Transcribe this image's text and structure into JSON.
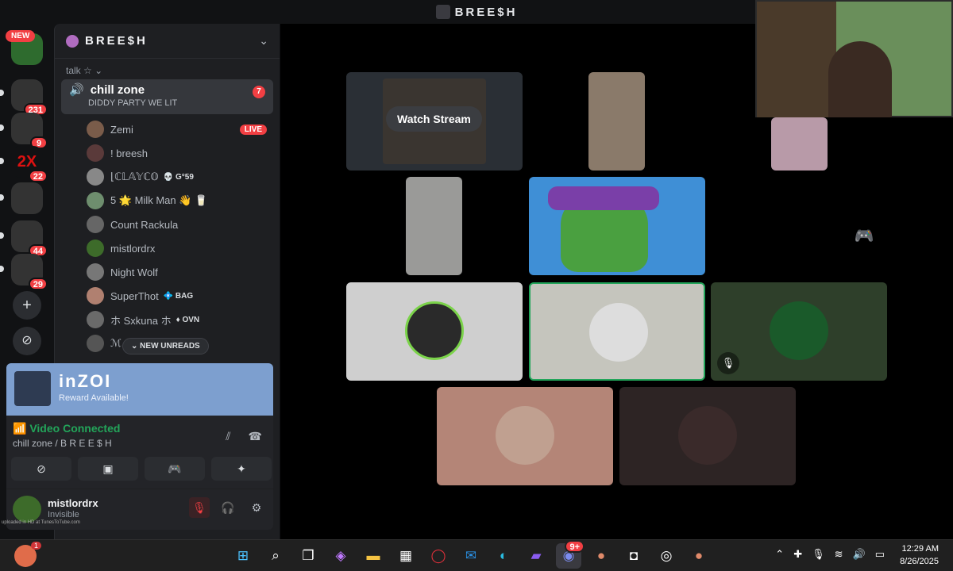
{
  "window": {
    "title": "BREE$H"
  },
  "rail": {
    "new_label": "NEW",
    "servers": [
      {
        "badge": "231",
        "color": "#c9c9c9"
      },
      {
        "badge": "9",
        "color": "#5a8f4a"
      },
      {
        "badge": "22",
        "color": "#b8161c"
      },
      {
        "badge": "",
        "color": "#d8b4d8"
      },
      {
        "badge": "44",
        "color": "#2f5fb0"
      },
      {
        "badge": "29",
        "color": "#c07a5c"
      }
    ],
    "add_icon": "+",
    "discover_icon": "compass-icon"
  },
  "sidebar": {
    "server_name": "BREE$H",
    "category": "talk ☆ ⌄",
    "channel": {
      "name": "chill zone",
      "status": "DIDDY PARTY WE LIT",
      "badge": "7"
    },
    "users": [
      {
        "name": "Zemi",
        "live": "LIVE",
        "color": "#7a5c4a"
      },
      {
        "name": "! breesh",
        "color": "#5a3a3a"
      },
      {
        "name": "⌊ℂ𝕃𝔸𝕐ℂ𝕆",
        "tag": "💀 G°59",
        "color": "#888"
      },
      {
        "name": "5 🌟 Milk Man 👋 🥛",
        "color": "#6e8e6e"
      },
      {
        "name": "Count Rackula",
        "color": "#666"
      },
      {
        "name": "mistlordrx",
        "color": "#3d6b2a"
      },
      {
        "name": "Night Wolf",
        "color": "#777"
      },
      {
        "name": "SuperThot",
        "tag": "💠 BAG",
        "color": "#b08070"
      },
      {
        "name": "ホ Sxkuna ホ",
        "tag": "♦ OVN",
        "color": "#6a6a6a"
      },
      {
        "name": "ℳ",
        "color": "#555"
      }
    ],
    "new_unreads": "NEW UNREADS"
  },
  "promo": {
    "brand": "inZOI",
    "reward": "Reward Available!"
  },
  "voice": {
    "status": "Video Connected",
    "location": "chill zone / B R E E $ H"
  },
  "me": {
    "username": "mistlordrx",
    "status": "Invisible"
  },
  "stage": {
    "watch_label": "Watch Stream"
  },
  "overlay": {
    "caption": "uploaded in HD at TunesToTube.com"
  },
  "taskbar": {
    "notif_badge": "1",
    "discord_badge": "9+"
  },
  "clock": {
    "time": "12:29 AM",
    "date": "8/26/2025"
  }
}
